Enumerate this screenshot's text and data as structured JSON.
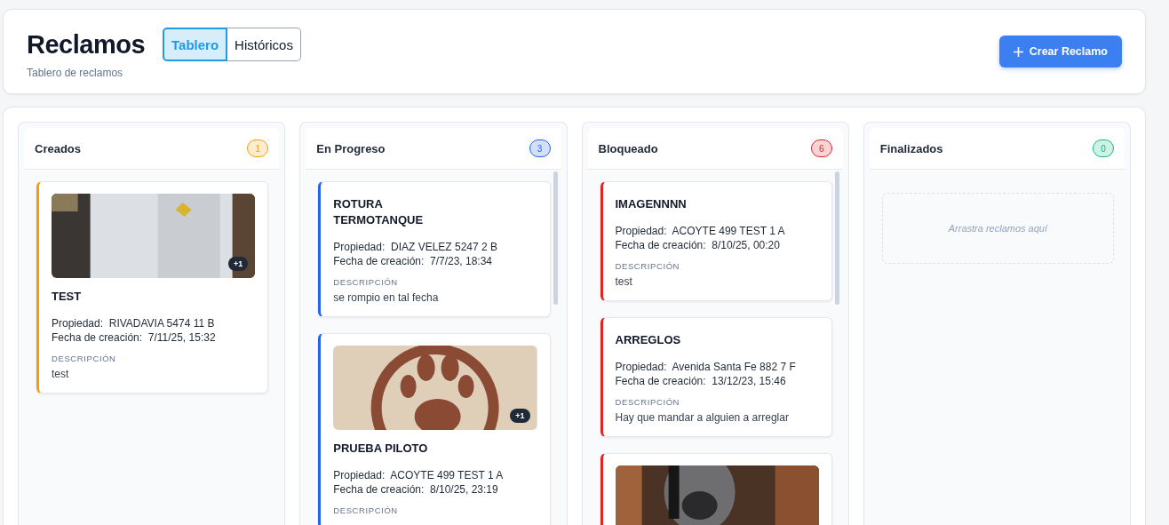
{
  "header": {
    "title": "Reclamos",
    "subtitle": "Tablero de reclamos",
    "tabs": [
      {
        "label": "Tablero",
        "selected": true
      },
      {
        "label": "Históricos",
        "selected": false
      }
    ],
    "create_button": "Crear Reclamo"
  },
  "columns": [
    {
      "title": "Creados",
      "count": "1",
      "color": "#f59e0b",
      "cards": [
        {
          "image": {
            "kind": "picture",
            "extra": "+1"
          },
          "title": "TEST",
          "property_label": "Propiedad:",
          "property": "RIVADAVIA 5474 11 B",
          "date_label": "Fecha de creación:",
          "date": "7/11/25, 15:32",
          "description_label": "DESCRIPCIÓN",
          "description": "test"
        }
      ]
    },
    {
      "title": "En Progreso",
      "count": "3",
      "color": "#2563eb",
      "cards": [
        {
          "title": "ROTURA\nTERMOTANQUE",
          "property_label": "Propiedad:",
          "property": "DIAZ VELEZ 5247 2 B",
          "date_label": "Fecha de creación:",
          "date": "7/7/23, 18:34",
          "description_label": "DESCRIPCIÓN",
          "description": "se rompio en tal fecha"
        },
        {
          "image": {
            "kind": "picture",
            "extra": "+1"
          },
          "title": "PRUEBA PILOTO",
          "property_label": "Propiedad:",
          "property": "ACOYTE 499 TEST 1 A",
          "date_label": "Fecha de creación:",
          "date": "8/10/25, 23:19",
          "description_label": "DESCRIPCIÓN"
        }
      ]
    },
    {
      "title": "Bloqueado",
      "count": "6",
      "color": "#dc2626",
      "cards": [
        {
          "title": "IMAGENNNN",
          "property_label": "Propiedad:",
          "property": "ACOYTE 499 TEST 1 A",
          "date_label": "Fecha de creación:",
          "date": "8/10/25, 00:20",
          "description_label": "DESCRIPCIÓN",
          "description": "test"
        },
        {
          "title": "ARREGLOS",
          "property_label": "Propiedad:",
          "property": "Avenida Santa Fe 882 7 F",
          "date_label": "Fecha de creación:",
          "date": "13/12/23, 15:46",
          "description_label": "DESCRIPCIÓN",
          "description": "Hay que mandar a alguien a arreglar"
        },
        {
          "image": {
            "kind": "picture"
          }
        }
      ]
    },
    {
      "title": "Finalizados",
      "count": "0",
      "color": "#10b981",
      "empty_text": "Arrastra reclamos aquí"
    }
  ]
}
